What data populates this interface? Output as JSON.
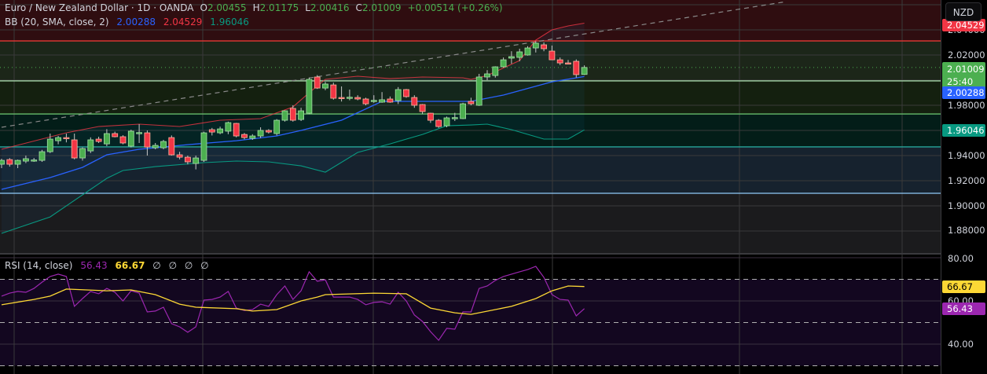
{
  "header": {
    "symbol": "Euro / New Zealand Dollar · 1D · OANDA",
    "o_label": "O",
    "o": "2.00455",
    "h_label": "H",
    "h": "2.01175",
    "l_label": "L",
    "l": "2.00416",
    "c_label": "C",
    "c": "2.01009",
    "change": "+0.00514 (+0.26%)"
  },
  "bb_legend": {
    "label": "BB (20, SMA, close, 2)",
    "basis": "2.00288",
    "upper": "2.04529",
    "lower": "1.96046"
  },
  "rsi_legend": {
    "label": "RSI (14, close)",
    "rsi": "56.43",
    "ma": "66.67",
    "extras": [
      "∅",
      "∅",
      "∅",
      "∅"
    ]
  },
  "axis": {
    "currency": "NZD",
    "price_labels": [
      "2.04000",
      "2.02000",
      "1.98000",
      "1.94000",
      "1.92000",
      "1.90000",
      "1.88000"
    ],
    "badges": {
      "upper": "2.04529",
      "last": "2.01009",
      "countdown": "25:40",
      "basis": "2.00288",
      "lower": "1.96046"
    },
    "rsi_labels": [
      "80.00",
      "60.00",
      "40.00"
    ],
    "rsi_badges": {
      "ma": "66.67",
      "rsi": "56.43"
    }
  },
  "colors": {
    "up": "#4caf50",
    "down": "#f23645",
    "basis": "#2962ff",
    "upper": "#f23645",
    "lower": "#089981",
    "rsi": "#9c27b0",
    "rsi_ma": "#fdd835"
  },
  "chart_data": [
    {
      "type": "candlestick",
      "title": "Euro / New Zealand Dollar · 1D · OANDA",
      "ylim": [
        1.87,
        2.06
      ],
      "yticks": [
        2.04,
        2.02,
        2.0,
        1.98,
        1.96,
        1.94,
        1.92,
        1.9,
        1.88
      ],
      "ohlc": [
        [
          1.9331,
          1.9375,
          1.93,
          1.9362
        ],
        [
          1.9368,
          1.938,
          1.9312,
          1.9331
        ],
        [
          1.9331,
          1.9368,
          1.93,
          1.9362
        ],
        [
          1.9356,
          1.94,
          1.934,
          1.9375
        ],
        [
          1.9362,
          1.9381,
          1.935,
          1.9365
        ],
        [
          1.9362,
          1.9445,
          1.935,
          1.9431
        ],
        [
          1.9431,
          1.9575,
          1.942,
          1.9531
        ],
        [
          1.9518,
          1.9556,
          1.949,
          1.9543
        ],
        [
          1.9543,
          1.9575,
          1.9505,
          1.9541
        ],
        [
          1.9525,
          1.9575,
          1.937,
          1.9381
        ],
        [
          1.9381,
          1.9465,
          1.936,
          1.9456
        ],
        [
          1.9437,
          1.9545,
          1.942,
          1.9525
        ],
        [
          1.9531,
          1.955,
          1.95,
          1.9512
        ],
        [
          1.9493,
          1.961,
          1.9475,
          1.9575
        ],
        [
          1.9575,
          1.959,
          1.9545,
          1.955
        ],
        [
          1.955,
          1.9562,
          1.949,
          1.95
        ],
        [
          1.9475,
          1.9606,
          1.9465,
          1.9594
        ],
        [
          1.9581,
          1.965,
          1.95,
          1.9583
        ],
        [
          1.9581,
          1.96,
          1.94,
          1.9468
        ],
        [
          1.9462,
          1.95,
          1.945,
          1.9481
        ],
        [
          1.9462,
          1.9525,
          1.945,
          1.9512
        ],
        [
          1.9543,
          1.956,
          1.94,
          1.9406
        ],
        [
          1.9406,
          1.943,
          1.937,
          1.9387
        ],
        [
          1.9387,
          1.94,
          1.933,
          1.935
        ],
        [
          1.9337,
          1.94,
          1.929,
          1.9381
        ],
        [
          1.9362,
          1.959,
          1.935,
          1.9581
        ],
        [
          1.9606,
          1.962,
          1.956,
          1.9587
        ],
        [
          1.9581,
          1.963,
          1.957,
          1.9612
        ],
        [
          1.9594,
          1.967,
          1.957,
          1.9662
        ],
        [
          1.9656,
          1.966,
          1.9545,
          1.9556
        ],
        [
          1.9568,
          1.958,
          1.953,
          1.9543
        ],
        [
          1.9537,
          1.957,
          1.9525,
          1.9556
        ],
        [
          1.9556,
          1.9625,
          1.954,
          1.96
        ],
        [
          1.96,
          1.961,
          1.9575,
          1.9587
        ],
        [
          1.9575,
          1.969,
          1.956,
          1.9681
        ],
        [
          1.9681,
          1.976,
          1.967,
          1.9756
        ],
        [
          1.9775,
          1.98,
          1.967,
          1.9681
        ],
        [
          1.9687,
          1.978,
          1.9675,
          1.9756
        ],
        [
          1.9737,
          2.002,
          1.973,
          2.0006
        ],
        [
          2.0025,
          2.004,
          1.993,
          1.9937
        ],
        [
          1.9937,
          1.9985,
          1.992,
          1.9969
        ],
        [
          1.9962,
          1.998,
          1.9845,
          1.9856
        ],
        [
          1.9862,
          1.995,
          1.983,
          1.986
        ],
        [
          1.9862,
          1.9925,
          1.984,
          1.9864
        ],
        [
          1.9862,
          1.988,
          1.984,
          1.985
        ],
        [
          1.985,
          1.986,
          1.98,
          1.9812
        ],
        [
          1.9837,
          1.988,
          1.982,
          1.9839
        ],
        [
          1.9825,
          1.9905,
          1.982,
          1.9844
        ],
        [
          1.985,
          1.987,
          1.982,
          1.9825
        ],
        [
          1.9837,
          1.9945,
          1.981,
          1.9925
        ],
        [
          1.9925,
          1.993,
          1.986,
          1.9869
        ],
        [
          1.9862,
          1.988,
          1.978,
          1.98
        ],
        [
          1.9806,
          1.981,
          1.973,
          1.975
        ],
        [
          1.9737,
          1.974,
          1.966,
          1.9681
        ],
        [
          1.9681,
          1.969,
          1.962,
          1.9631
        ],
        [
          1.9637,
          1.971,
          1.9625,
          1.97
        ],
        [
          1.97,
          1.974,
          1.9675,
          1.9702
        ],
        [
          1.9694,
          1.982,
          1.969,
          1.9812
        ],
        [
          1.9831,
          1.986,
          1.98,
          1.9812
        ],
        [
          1.98,
          2.005,
          1.9795,
          2.0025
        ],
        [
          2.0025,
          2.008,
          2.0,
          2.005
        ],
        [
          2.0037,
          2.011,
          2.002,
          2.0106
        ],
        [
          2.0106,
          2.018,
          2.01,
          2.0162
        ],
        [
          2.0175,
          2.023,
          2.013,
          2.0187
        ],
        [
          2.0181,
          2.025,
          2.015,
          2.0225
        ],
        [
          2.02,
          2.027,
          2.0195,
          2.0256
        ],
        [
          2.0256,
          2.031,
          2.022,
          2.0294
        ],
        [
          2.0281,
          2.03,
          2.023,
          2.025
        ],
        [
          2.0231,
          2.0275,
          2.016,
          2.0162
        ],
        [
          2.0162,
          2.018,
          2.012,
          2.0137
        ],
        [
          2.0137,
          2.016,
          2.0125,
          2.0135
        ],
        [
          2.015,
          2.0165,
          2.002,
          2.0044
        ],
        [
          2.00455,
          2.01175,
          2.00416,
          2.01009
        ]
      ],
      "bollinger": {
        "upper": [
          [
            0,
            1.945
          ],
          [
            8,
            1.9581
          ],
          [
            12,
            1.9631
          ],
          [
            17,
            1.965
          ],
          [
            22,
            1.9631
          ],
          [
            27,
            1.9681
          ],
          [
            32,
            1.9694
          ],
          [
            36,
            1.9787
          ],
          [
            38,
            1.99
          ],
          [
            40,
            2.0006
          ],
          [
            44,
            2.0031
          ],
          [
            48,
            2.0012
          ],
          [
            52,
            2.0025
          ],
          [
            57,
            2.0019
          ],
          [
            58,
            2.0006
          ],
          [
            60,
            2.0037
          ],
          [
            64,
            2.0156
          ],
          [
            66,
            2.0319
          ],
          [
            68,
            2.04
          ],
          [
            70,
            2.0431
          ],
          [
            72,
            2.04529
          ]
        ],
        "basis": [
          [
            0,
            1.9131
          ],
          [
            6,
            1.9225
          ],
          [
            10,
            1.9306
          ],
          [
            13,
            1.9406
          ],
          [
            17,
            1.945
          ],
          [
            23,
            1.9487
          ],
          [
            29,
            1.9518
          ],
          [
            34,
            1.9556
          ],
          [
            37,
            1.96
          ],
          [
            42,
            1.9681
          ],
          [
            47,
            1.9831
          ],
          [
            58,
            1.9831
          ],
          [
            62,
            1.9881
          ],
          [
            68,
            1.9987
          ],
          [
            72,
            2.00288
          ]
        ],
        "lower": [
          [
            0,
            1.8781
          ],
          [
            6,
            1.8912
          ],
          [
            11,
            1.9131
          ],
          [
            13,
            1.9219
          ],
          [
            15,
            1.9281
          ],
          [
            19,
            1.9312
          ],
          [
            25,
            1.9344
          ],
          [
            29,
            1.9356
          ],
          [
            33,
            1.935
          ],
          [
            37,
            1.9318
          ],
          [
            40,
            1.9268
          ],
          [
            44,
            1.9425
          ],
          [
            48,
            1.9493
          ],
          [
            52,
            1.9568
          ],
          [
            55,
            1.9637
          ],
          [
            58,
            1.9643
          ],
          [
            60,
            1.965
          ],
          [
            63,
            1.9606
          ],
          [
            67,
            1.9531
          ],
          [
            70,
            1.9531
          ],
          [
            72,
            1.96046
          ]
        ]
      },
      "horizontal_levels": [
        {
          "price": 2.0312,
          "color": "#e53935"
        },
        {
          "price": 1.9994,
          "color": "#a5d6a7"
        },
        {
          "price": 1.9731,
          "color": "#66bb6a"
        },
        {
          "price": 1.9469,
          "color": "#26a69a"
        },
        {
          "price": 1.91,
          "color": "#90caf9"
        }
      ],
      "zones": [
        {
          "from": 2.0312,
          "to": 2.07,
          "color": "#2f0d10"
        },
        {
          "from": 1.9994,
          "to": 2.0312,
          "color": "#1c2619"
        },
        {
          "from": 1.9731,
          "to": 1.9994,
          "color": "#14200f"
        },
        {
          "from": 1.9469,
          "to": 1.9731,
          "color": "#031d18"
        },
        {
          "from": 1.91,
          "to": 1.9469,
          "color": "#16222e"
        },
        {
          "from": 1.86,
          "to": 1.91,
          "color": "#1b1b1d"
        }
      ],
      "trendline": [
        [
          0,
          1.9625
        ],
        [
          97,
          2.0625
        ]
      ],
      "last_price": 2.01009
    },
    {
      "type": "line",
      "title": "RSI (14, close)",
      "ylim": [
        28,
        83
      ],
      "yticks": [
        80,
        60,
        40
      ],
      "bands": [
        70,
        50,
        30
      ],
      "series": [
        {
          "name": "RSI",
          "values": [
            62.2,
            63.6,
            64.4,
            64.0,
            65.8,
            68.7,
            71.3,
            72.4,
            71.3,
            57.5,
            61.1,
            64.4,
            63.3,
            65.8,
            64.0,
            60.0,
            64.7,
            63.6,
            54.9,
            55.3,
            57.1,
            49.5,
            48.0,
            45.5,
            48.0,
            60.4,
            60.7,
            61.8,
            64.4,
            56.7,
            55.6,
            56.0,
            58.5,
            57.5,
            62.9,
            66.9,
            60.7,
            64.7,
            73.5,
            69.1,
            69.8,
            61.8,
            61.8,
            61.8,
            60.7,
            58.2,
            59.3,
            59.6,
            58.5,
            64.0,
            60.0,
            53.5,
            50.5,
            45.8,
            41.8,
            47.3,
            46.9,
            54.9,
            54.9,
            65.8,
            66.9,
            69.5,
            71.3,
            72.4,
            73.5,
            74.5,
            76.0,
            70.9,
            62.9,
            60.7,
            60.4,
            53.1,
            56.43
          ]
        },
        {
          "name": "RSI MA",
          "points": [
            [
              0,
              58.2
            ],
            [
              4,
              60.7
            ],
            [
              6,
              62.2
            ],
            [
              8,
              65.5
            ],
            [
              13,
              64.7
            ],
            [
              16,
              65.1
            ],
            [
              19,
              62.9
            ],
            [
              22,
              58.5
            ],
            [
              24,
              57.1
            ],
            [
              29,
              56.4
            ],
            [
              31,
              55.3
            ],
            [
              34,
              56.0
            ],
            [
              37,
              60.0
            ],
            [
              39,
              61.8
            ],
            [
              40,
              62.9
            ],
            [
              46,
              63.6
            ],
            [
              50,
              63.3
            ],
            [
              53,
              56.7
            ],
            [
              56,
              54.5
            ],
            [
              58,
              53.8
            ],
            [
              63,
              57.5
            ],
            [
              66,
              61.1
            ],
            [
              68,
              64.7
            ],
            [
              70,
              66.9
            ],
            [
              72,
              66.67
            ]
          ]
        }
      ]
    }
  ]
}
